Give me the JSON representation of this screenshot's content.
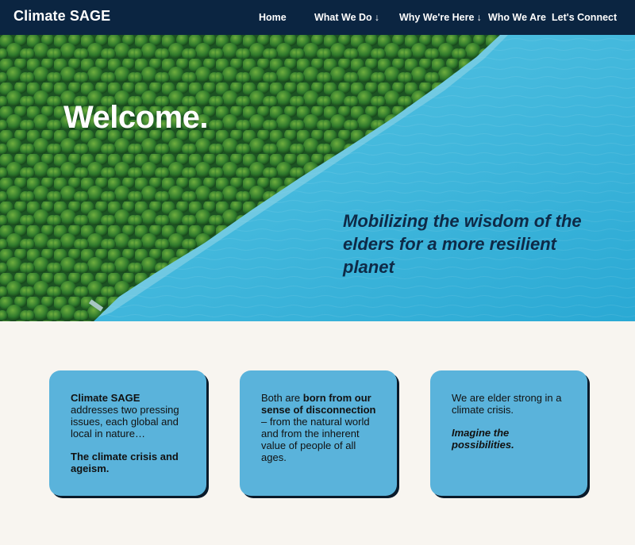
{
  "brand": "Climate SAGE",
  "nav": {
    "home": "Home",
    "what_we_do": "What We Do",
    "why_here": "Why We're Here",
    "who_we_are": "Who We Are",
    "connect": "Let's Connect",
    "dropdown_arrow": "🡣"
  },
  "hero": {
    "title": "Welcome.",
    "tagline": "Mobilizing the wisdom of the elders for a more resilient planet"
  },
  "cards": [
    {
      "lead_bold": "Climate SAGE",
      "lead_text": "addresses two pressing issues, each global and local in nature…",
      "closing_bold": "The climate crisis and ageism."
    },
    {
      "pre": "Both are ",
      "bold": "born from our sense of disconnection",
      "post": " – from the natural world and from the inherent value of people of all ages."
    },
    {
      "text": "We are elder strong in a climate crisis.",
      "closing_bold_italic": "Imagine the possibilities."
    }
  ],
  "colors": {
    "nav_bg": "#0b2541",
    "page_bg": "#f8f5f0",
    "card_bg": "#5ab3db",
    "water": "#3fb6d8",
    "forest": "#2d6a2a",
    "tagline": "#0e2a47"
  }
}
